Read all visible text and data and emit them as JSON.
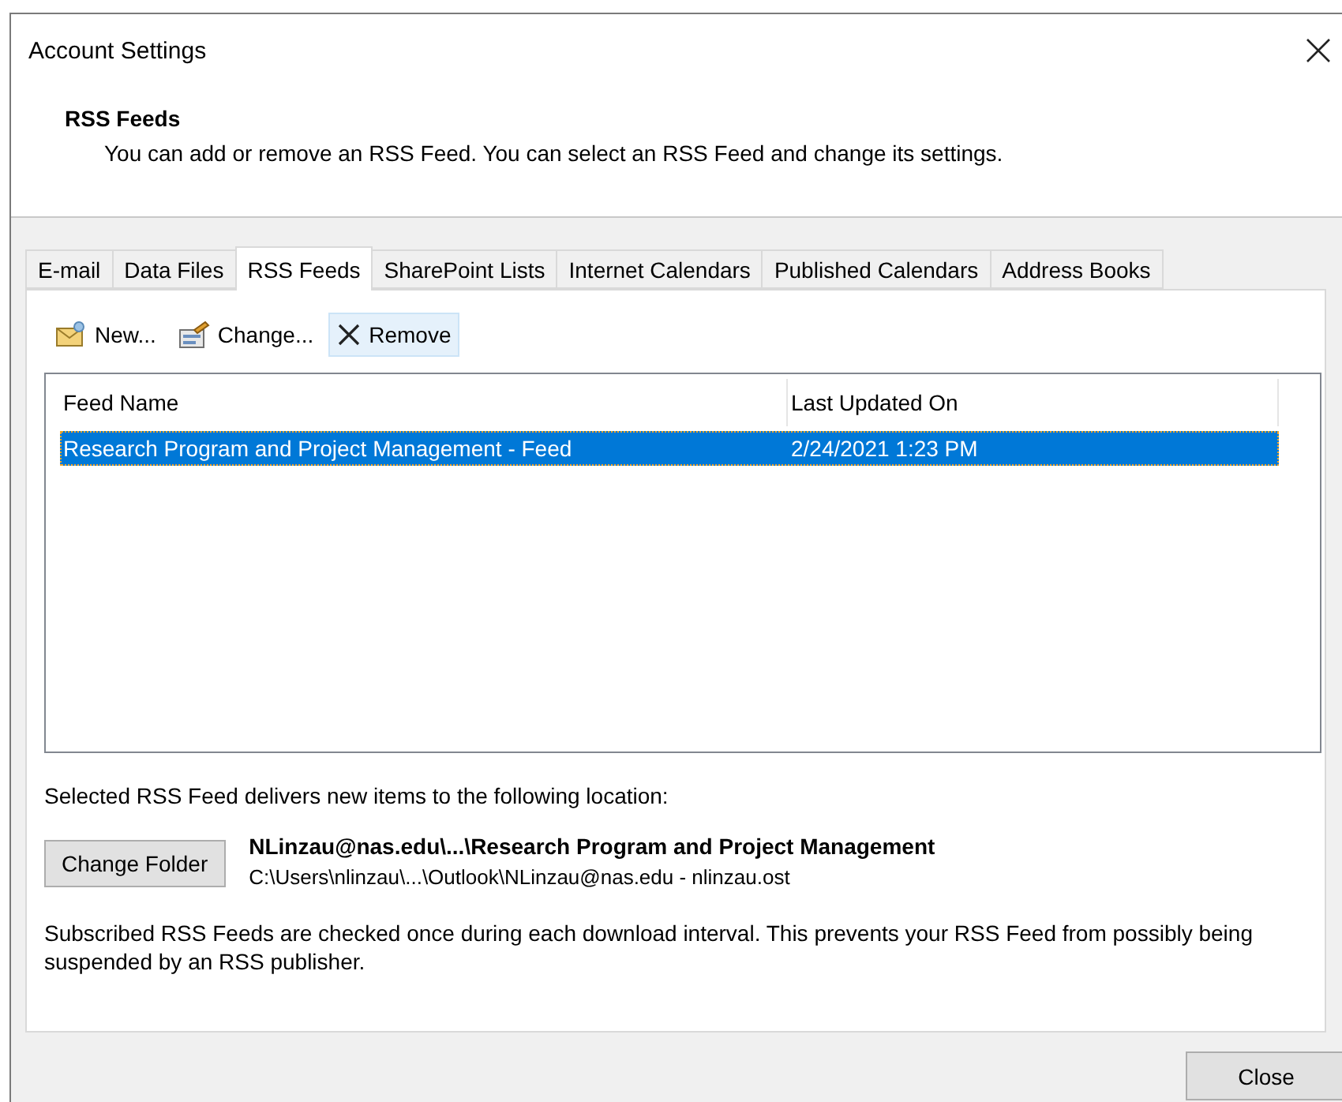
{
  "window": {
    "title": "Account Settings"
  },
  "header": {
    "title": "RSS Feeds",
    "description": "You can add or remove an RSS Feed. You can select an RSS Feed and change its settings."
  },
  "tabs": [
    {
      "label": "E-mail",
      "selected": false
    },
    {
      "label": "Data Files",
      "selected": false
    },
    {
      "label": "RSS Feeds",
      "selected": true
    },
    {
      "label": "SharePoint Lists",
      "selected": false
    },
    {
      "label": "Internet Calendars",
      "selected": false
    },
    {
      "label": "Published Calendars",
      "selected": false
    },
    {
      "label": "Address Books",
      "selected": false
    }
  ],
  "toolbar": [
    {
      "kind": "new",
      "label": "New...",
      "highlighted": false
    },
    {
      "kind": "change",
      "label": "Change...",
      "highlighted": false
    },
    {
      "kind": "remove",
      "label": "Remove",
      "highlighted": true
    }
  ],
  "table": {
    "columns": [
      "Feed Name",
      "Last Updated On"
    ],
    "rows": [
      {
        "cells": [
          "Research Program and Project Management - Feed",
          "2/24/2021 1:23 PM"
        ],
        "selected": true
      }
    ]
  },
  "location": {
    "label": "Selected RSS Feed delivers new items to the following location:",
    "button": "Change Folder",
    "folder": "NLinzau@nas.edu\\...\\Research Program and Project Management",
    "path": "C:\\Users\\nlinzau\\...\\Outlook\\NLinzau@nas.edu - nlinzau.ost"
  },
  "note": "Subscribed RSS Feeds are checked once during each download interval. This prevents your RSS Feed from possibly being suspended by an RSS publisher.",
  "buttons": [
    "Close"
  ]
}
